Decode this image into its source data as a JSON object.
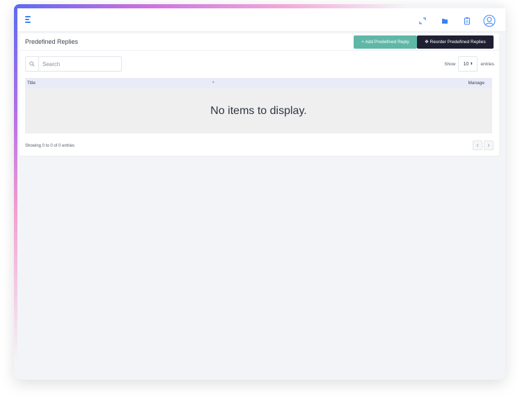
{
  "header": {
    "icons": [
      "menu-icon",
      "expand-icon",
      "folder-icon",
      "clipboard-icon",
      "user-avatar-icon"
    ]
  },
  "card": {
    "title": "Predefined Replies",
    "add_button": "+ Add Predefined Reply",
    "reorder_button": "Reorder Predefined Replies"
  },
  "search": {
    "placeholder": "Search",
    "value": ""
  },
  "length": {
    "show_label": "Show",
    "selected": "10",
    "entries_label": "entries"
  },
  "table": {
    "columns": [
      "Title",
      "Manage"
    ],
    "sort_indicator": "▲",
    "rows": [],
    "empty_message": "No items to display."
  },
  "footer": {
    "info": "Showing 0 to 0 of 0 entries"
  },
  "colors": {
    "accent": "#3b82f6",
    "add_button": "#5fb8a6",
    "reorder_button": "#1f2132",
    "table_head": "#e9ecf8"
  }
}
